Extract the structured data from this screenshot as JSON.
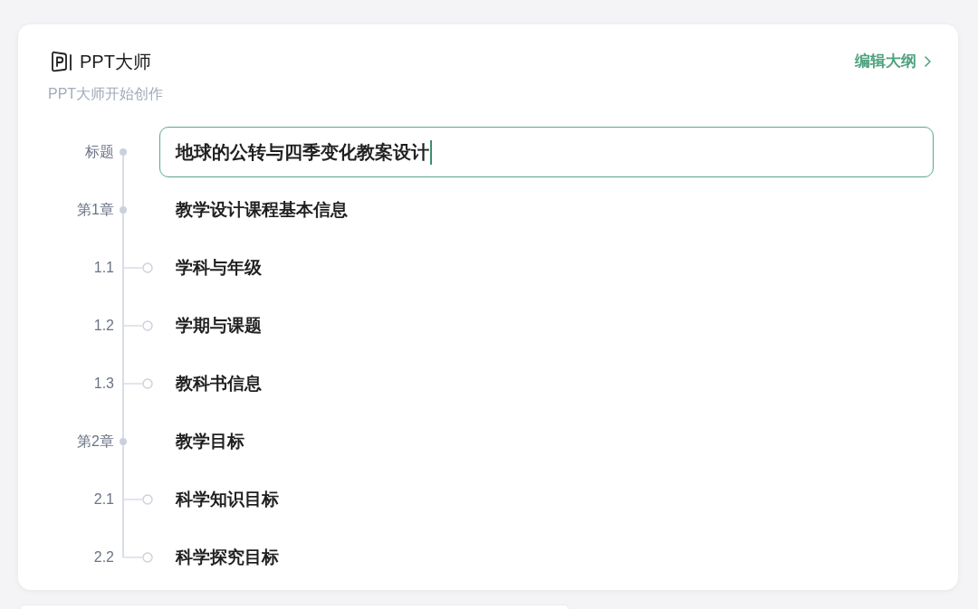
{
  "header": {
    "title": "PPT大师",
    "subtitle": "PPT大师开始创作",
    "edit_link": "编辑大纲"
  },
  "outline": {
    "title": {
      "label": "标题",
      "value": "地球的公转与四季变化教案设计",
      "focused": true
    },
    "chapters": [
      {
        "label": "第1章",
        "text": "教学设计课程基本信息",
        "children": [
          {
            "label": "1.1",
            "text": "学科与年级"
          },
          {
            "label": "1.2",
            "text": "学期与课题"
          },
          {
            "label": "1.3",
            "text": "教科书信息"
          }
        ]
      },
      {
        "label": "第2章",
        "text": "教学目标",
        "children": [
          {
            "label": "2.1",
            "text": "科学知识目标"
          },
          {
            "label": "2.2",
            "text": "科学探究目标"
          }
        ]
      }
    ]
  }
}
